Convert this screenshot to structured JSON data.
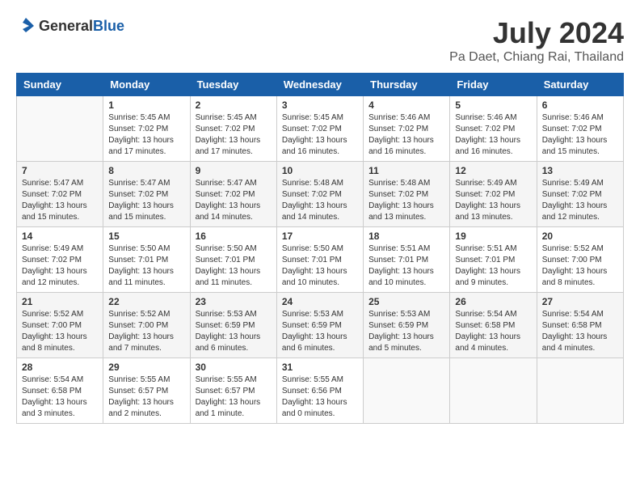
{
  "header": {
    "logo_general": "General",
    "logo_blue": "Blue",
    "title": "July 2024",
    "subtitle": "Pa Daet, Chiang Rai, Thailand"
  },
  "columns": [
    "Sunday",
    "Monday",
    "Tuesday",
    "Wednesday",
    "Thursday",
    "Friday",
    "Saturday"
  ],
  "weeks": [
    [
      {
        "day": "",
        "content": ""
      },
      {
        "day": "1",
        "content": "Sunrise: 5:45 AM\nSunset: 7:02 PM\nDaylight: 13 hours\nand 17 minutes."
      },
      {
        "day": "2",
        "content": "Sunrise: 5:45 AM\nSunset: 7:02 PM\nDaylight: 13 hours\nand 17 minutes."
      },
      {
        "day": "3",
        "content": "Sunrise: 5:45 AM\nSunset: 7:02 PM\nDaylight: 13 hours\nand 16 minutes."
      },
      {
        "day": "4",
        "content": "Sunrise: 5:46 AM\nSunset: 7:02 PM\nDaylight: 13 hours\nand 16 minutes."
      },
      {
        "day": "5",
        "content": "Sunrise: 5:46 AM\nSunset: 7:02 PM\nDaylight: 13 hours\nand 16 minutes."
      },
      {
        "day": "6",
        "content": "Sunrise: 5:46 AM\nSunset: 7:02 PM\nDaylight: 13 hours\nand 15 minutes."
      }
    ],
    [
      {
        "day": "7",
        "content": "Sunrise: 5:47 AM\nSunset: 7:02 PM\nDaylight: 13 hours\nand 15 minutes."
      },
      {
        "day": "8",
        "content": "Sunrise: 5:47 AM\nSunset: 7:02 PM\nDaylight: 13 hours\nand 15 minutes."
      },
      {
        "day": "9",
        "content": "Sunrise: 5:47 AM\nSunset: 7:02 PM\nDaylight: 13 hours\nand 14 minutes."
      },
      {
        "day": "10",
        "content": "Sunrise: 5:48 AM\nSunset: 7:02 PM\nDaylight: 13 hours\nand 14 minutes."
      },
      {
        "day": "11",
        "content": "Sunrise: 5:48 AM\nSunset: 7:02 PM\nDaylight: 13 hours\nand 13 minutes."
      },
      {
        "day": "12",
        "content": "Sunrise: 5:49 AM\nSunset: 7:02 PM\nDaylight: 13 hours\nand 13 minutes."
      },
      {
        "day": "13",
        "content": "Sunrise: 5:49 AM\nSunset: 7:02 PM\nDaylight: 13 hours\nand 12 minutes."
      }
    ],
    [
      {
        "day": "14",
        "content": "Sunrise: 5:49 AM\nSunset: 7:02 PM\nDaylight: 13 hours\nand 12 minutes."
      },
      {
        "day": "15",
        "content": "Sunrise: 5:50 AM\nSunset: 7:01 PM\nDaylight: 13 hours\nand 11 minutes."
      },
      {
        "day": "16",
        "content": "Sunrise: 5:50 AM\nSunset: 7:01 PM\nDaylight: 13 hours\nand 11 minutes."
      },
      {
        "day": "17",
        "content": "Sunrise: 5:50 AM\nSunset: 7:01 PM\nDaylight: 13 hours\nand 10 minutes."
      },
      {
        "day": "18",
        "content": "Sunrise: 5:51 AM\nSunset: 7:01 PM\nDaylight: 13 hours\nand 10 minutes."
      },
      {
        "day": "19",
        "content": "Sunrise: 5:51 AM\nSunset: 7:01 PM\nDaylight: 13 hours\nand 9 minutes."
      },
      {
        "day": "20",
        "content": "Sunrise: 5:52 AM\nSunset: 7:00 PM\nDaylight: 13 hours\nand 8 minutes."
      }
    ],
    [
      {
        "day": "21",
        "content": "Sunrise: 5:52 AM\nSunset: 7:00 PM\nDaylight: 13 hours\nand 8 minutes."
      },
      {
        "day": "22",
        "content": "Sunrise: 5:52 AM\nSunset: 7:00 PM\nDaylight: 13 hours\nand 7 minutes."
      },
      {
        "day": "23",
        "content": "Sunrise: 5:53 AM\nSunset: 6:59 PM\nDaylight: 13 hours\nand 6 minutes."
      },
      {
        "day": "24",
        "content": "Sunrise: 5:53 AM\nSunset: 6:59 PM\nDaylight: 13 hours\nand 6 minutes."
      },
      {
        "day": "25",
        "content": "Sunrise: 5:53 AM\nSunset: 6:59 PM\nDaylight: 13 hours\nand 5 minutes."
      },
      {
        "day": "26",
        "content": "Sunrise: 5:54 AM\nSunset: 6:58 PM\nDaylight: 13 hours\nand 4 minutes."
      },
      {
        "day": "27",
        "content": "Sunrise: 5:54 AM\nSunset: 6:58 PM\nDaylight: 13 hours\nand 4 minutes."
      }
    ],
    [
      {
        "day": "28",
        "content": "Sunrise: 5:54 AM\nSunset: 6:58 PM\nDaylight: 13 hours\nand 3 minutes."
      },
      {
        "day": "29",
        "content": "Sunrise: 5:55 AM\nSunset: 6:57 PM\nDaylight: 13 hours\nand 2 minutes."
      },
      {
        "day": "30",
        "content": "Sunrise: 5:55 AM\nSunset: 6:57 PM\nDaylight: 13 hours\nand 1 minute."
      },
      {
        "day": "31",
        "content": "Sunrise: 5:55 AM\nSunset: 6:56 PM\nDaylight: 13 hours\nand 0 minutes."
      },
      {
        "day": "",
        "content": ""
      },
      {
        "day": "",
        "content": ""
      },
      {
        "day": "",
        "content": ""
      }
    ]
  ]
}
